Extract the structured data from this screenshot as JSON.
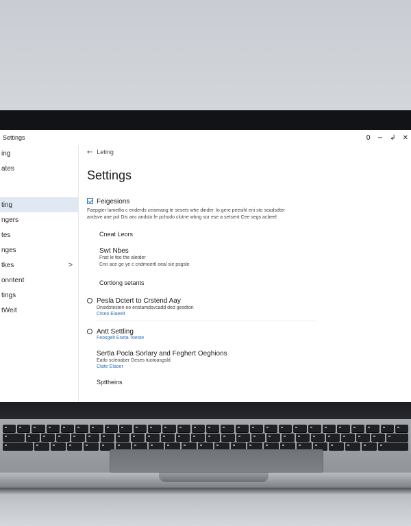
{
  "window": {
    "title": "Settings",
    "controls": [
      "0",
      "−",
      "↲",
      "✕"
    ]
  },
  "sidebar": {
    "items": [
      {
        "label": "ing"
      },
      {
        "label": "ates"
      },
      {
        "label": ""
      },
      {
        "label": "ting",
        "active": true
      },
      {
        "label": "ngers"
      },
      {
        "label": "tes"
      },
      {
        "label": "nges"
      },
      {
        "label": "tkes",
        "chevron": ">"
      },
      {
        "label": "onntent"
      },
      {
        "label": "tings"
      },
      {
        "label": "tWeit"
      }
    ]
  },
  "main": {
    "back_label": "Leting",
    "page_title": "Settings",
    "sections": [
      {
        "kind": "checkbox",
        "heading": "Feigesions",
        "lines": [
          "Faepgter lametlio c enderds ceismang te sesets whe dinder. lo gere peesihl eni sto seadsdter",
          "andsve ane pol Dis anc andslo fe pchudo clutne wbng sor ese a setsent Cee segs acbeel"
        ]
      },
      {
        "kind": "subhead",
        "heading": "Cneat Leors"
      },
      {
        "kind": "plain",
        "heading": "Swt Nbes",
        "lines": [
          "Fnst le feo the aletder",
          "Cnn ace ge ye c cndmoertl oeal sie psgsle"
        ]
      },
      {
        "kind": "subhead",
        "heading": "Cortlong setants"
      },
      {
        "kind": "radio",
        "heading": "Pesla Dctert to Crstend Aay",
        "lines": [
          "Dnsidstesten eo enstamdsvcadd ded gesdton"
        ],
        "link": "Ctseo Elaeelt"
      },
      {
        "kind": "radio",
        "heading": "Antt Settling",
        "lines": [],
        "link": "Feosgelt Eseta Toeste"
      },
      {
        "kind": "plain",
        "heading": "Sertla Pocla Sorlary and Feghert Oeghions",
        "lines": [
          "Eatlo scleoaber Deses tuotoasgsld"
        ],
        "link": "Ctate Elaoer"
      },
      {
        "kind": "subhead",
        "heading": "Spttheins"
      }
    ]
  }
}
